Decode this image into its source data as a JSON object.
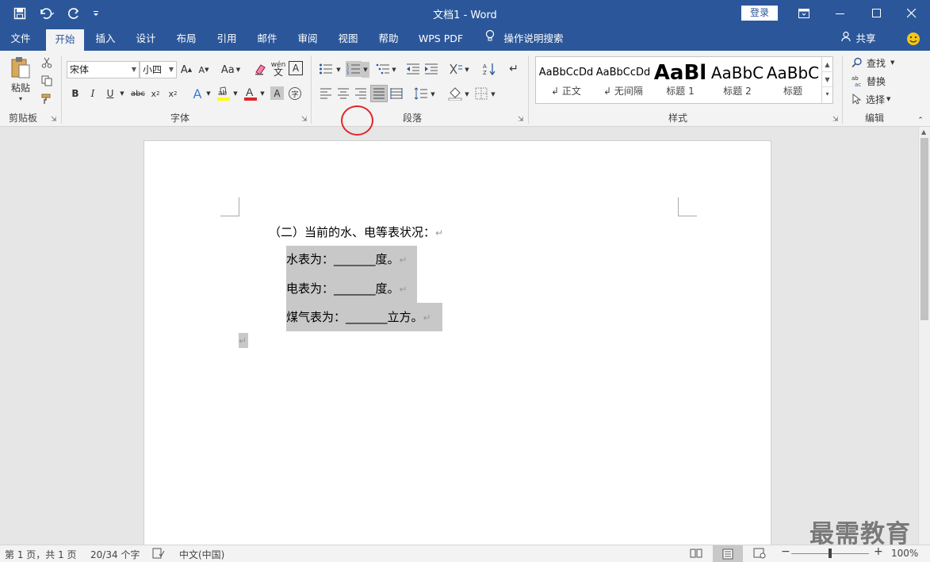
{
  "titlebar": {
    "title": "文档1  -  Word",
    "login": "登录"
  },
  "tabs": [
    "文件",
    "开始",
    "插入",
    "设计",
    "布局",
    "引用",
    "邮件",
    "审阅",
    "视图",
    "帮助",
    "WPS PDF",
    "操作说明搜索"
  ],
  "share": "共享",
  "ribbon": {
    "clipboard": {
      "paste": "粘贴",
      "label": "剪贴板"
    },
    "font": {
      "name": "宋体",
      "size": "小四",
      "label": "字体",
      "aa": "Aa",
      "wen": "wén"
    },
    "paragraph": {
      "label": "段落"
    },
    "styles": {
      "label": "样式",
      "items": [
        {
          "preview": "AaBbCcDd",
          "name": "正文"
        },
        {
          "preview": "AaBbCcDd",
          "name": "无间隔"
        },
        {
          "preview": "AaBl",
          "name": "标题 1"
        },
        {
          "preview": "AaBbC",
          "name": "标题 2"
        },
        {
          "preview": "AaBbC",
          "name": "标题"
        }
      ]
    },
    "editing": {
      "find": "查找",
      "replace": "替换",
      "select": "选择",
      "label": "编辑"
    }
  },
  "document": {
    "heading": "（二）当前的水、电等表状况：",
    "lines": [
      "水表为：_______度。",
      "电表为：_______度。",
      "煤气表为：_______立方。"
    ],
    "para_mark": "↵"
  },
  "status": {
    "page": "第 1 页，共 1 页",
    "words": "20/34 个字",
    "lang": "中文(中国)",
    "zoom": "100%"
  },
  "watermark": "最需教育"
}
